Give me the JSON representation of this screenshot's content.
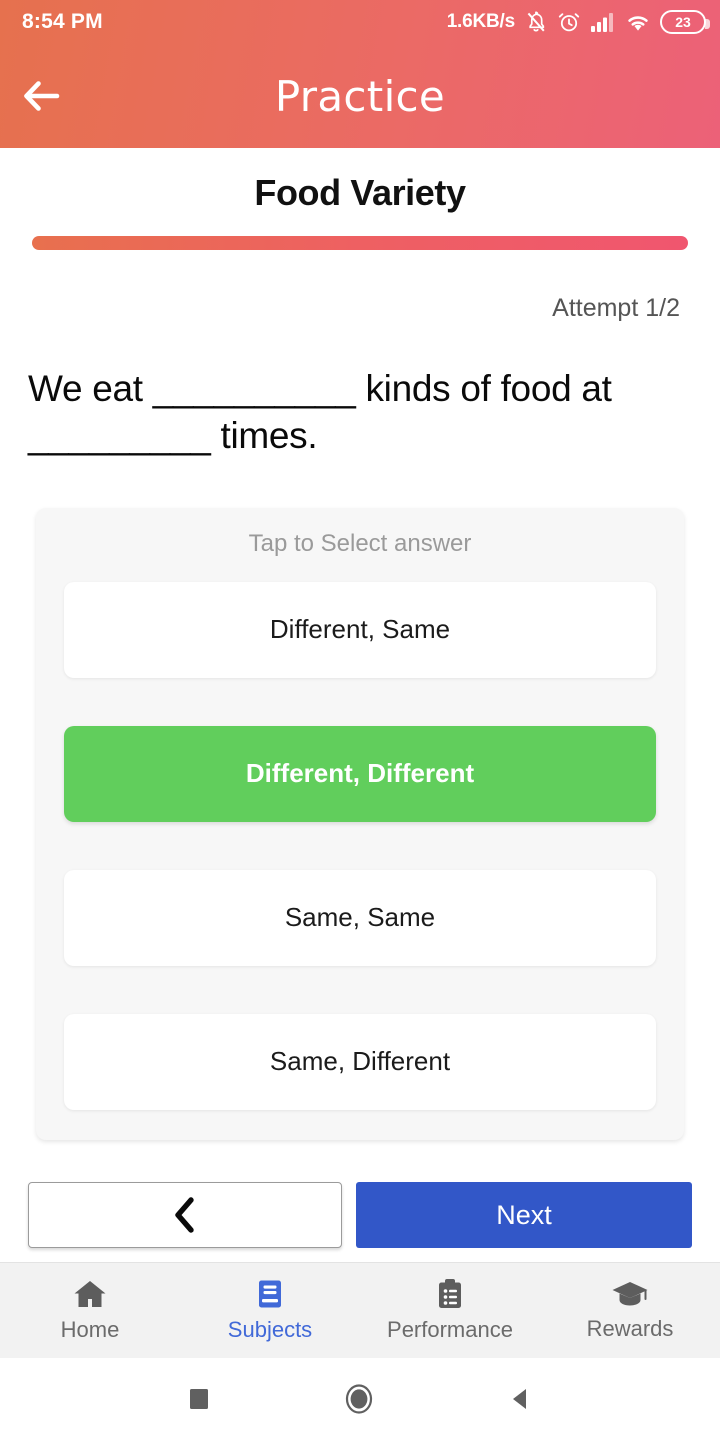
{
  "status_bar": {
    "time": "8:54 PM",
    "network_speed": "1.6KB/s",
    "icons": [
      "bell-muted-icon",
      "alarm-icon",
      "signal-icon",
      "wifi-icon"
    ],
    "battery_level": "23"
  },
  "app_bar": {
    "title": "Practice",
    "back_icon": "arrow-left-icon"
  },
  "lesson": {
    "title": "Food Variety",
    "progress_percent": 100,
    "attempt_label": "Attempt 1/2"
  },
  "question": {
    "text": "We eat __________ kinds of food at _________ times."
  },
  "answers": {
    "hint": "Tap to Select answer",
    "options": [
      {
        "label": "Different, Same",
        "selected": false
      },
      {
        "label": "Different, Different",
        "selected": true
      },
      {
        "label": "Same, Same",
        "selected": false
      },
      {
        "label": "Same, Different",
        "selected": false
      }
    ]
  },
  "nav_buttons": {
    "prev_icon": "chevron-left-icon",
    "next_label": "Next"
  },
  "bottom_nav": {
    "items": [
      {
        "label": "Home",
        "icon": "home-icon",
        "active": false
      },
      {
        "label": "Subjects",
        "icon": "book-icon",
        "active": true
      },
      {
        "label": "Performance",
        "icon": "clipboard-icon",
        "active": false
      },
      {
        "label": "Rewards",
        "icon": "graduation-cap-icon",
        "active": false
      }
    ]
  },
  "system_nav": {
    "recents_icon": "square-icon",
    "home_icon": "circle-icon",
    "back_icon": "triangle-left-icon"
  },
  "colors": {
    "header_start": "#E6714E",
    "header_end": "#EC6178",
    "progress_start": "#E8704E",
    "progress_end": "#F0566F",
    "selected_green": "#61CE5C",
    "next_blue": "#3257C8",
    "active_nav_blue": "#4169D8"
  }
}
